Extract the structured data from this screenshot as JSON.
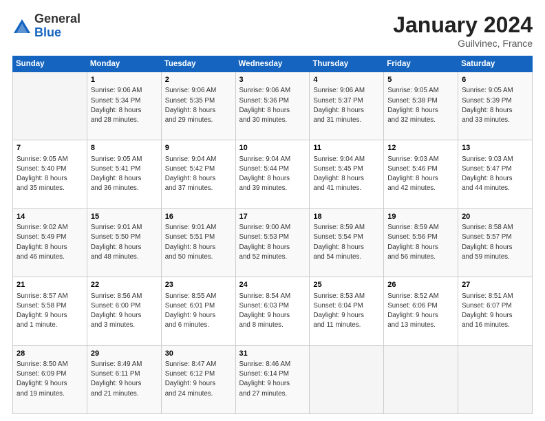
{
  "header": {
    "logo_general": "General",
    "logo_blue": "Blue",
    "title": "January 2024",
    "location": "Guilvinec, France"
  },
  "days_of_week": [
    "Sunday",
    "Monday",
    "Tuesday",
    "Wednesday",
    "Thursday",
    "Friday",
    "Saturday"
  ],
  "weeks": [
    [
      {
        "day": "",
        "info": ""
      },
      {
        "day": "1",
        "info": "Sunrise: 9:06 AM\nSunset: 5:34 PM\nDaylight: 8 hours\nand 28 minutes."
      },
      {
        "day": "2",
        "info": "Sunrise: 9:06 AM\nSunset: 5:35 PM\nDaylight: 8 hours\nand 29 minutes."
      },
      {
        "day": "3",
        "info": "Sunrise: 9:06 AM\nSunset: 5:36 PM\nDaylight: 8 hours\nand 30 minutes."
      },
      {
        "day": "4",
        "info": "Sunrise: 9:06 AM\nSunset: 5:37 PM\nDaylight: 8 hours\nand 31 minutes."
      },
      {
        "day": "5",
        "info": "Sunrise: 9:05 AM\nSunset: 5:38 PM\nDaylight: 8 hours\nand 32 minutes."
      },
      {
        "day": "6",
        "info": "Sunrise: 9:05 AM\nSunset: 5:39 PM\nDaylight: 8 hours\nand 33 minutes."
      }
    ],
    [
      {
        "day": "7",
        "info": "Sunrise: 9:05 AM\nSunset: 5:40 PM\nDaylight: 8 hours\nand 35 minutes."
      },
      {
        "day": "8",
        "info": "Sunrise: 9:05 AM\nSunset: 5:41 PM\nDaylight: 8 hours\nand 36 minutes."
      },
      {
        "day": "9",
        "info": "Sunrise: 9:04 AM\nSunset: 5:42 PM\nDaylight: 8 hours\nand 37 minutes."
      },
      {
        "day": "10",
        "info": "Sunrise: 9:04 AM\nSunset: 5:44 PM\nDaylight: 8 hours\nand 39 minutes."
      },
      {
        "day": "11",
        "info": "Sunrise: 9:04 AM\nSunset: 5:45 PM\nDaylight: 8 hours\nand 41 minutes."
      },
      {
        "day": "12",
        "info": "Sunrise: 9:03 AM\nSunset: 5:46 PM\nDaylight: 8 hours\nand 42 minutes."
      },
      {
        "day": "13",
        "info": "Sunrise: 9:03 AM\nSunset: 5:47 PM\nDaylight: 8 hours\nand 44 minutes."
      }
    ],
    [
      {
        "day": "14",
        "info": "Sunrise: 9:02 AM\nSunset: 5:49 PM\nDaylight: 8 hours\nand 46 minutes."
      },
      {
        "day": "15",
        "info": "Sunrise: 9:01 AM\nSunset: 5:50 PM\nDaylight: 8 hours\nand 48 minutes."
      },
      {
        "day": "16",
        "info": "Sunrise: 9:01 AM\nSunset: 5:51 PM\nDaylight: 8 hours\nand 50 minutes."
      },
      {
        "day": "17",
        "info": "Sunrise: 9:00 AM\nSunset: 5:53 PM\nDaylight: 8 hours\nand 52 minutes."
      },
      {
        "day": "18",
        "info": "Sunrise: 8:59 AM\nSunset: 5:54 PM\nDaylight: 8 hours\nand 54 minutes."
      },
      {
        "day": "19",
        "info": "Sunrise: 8:59 AM\nSunset: 5:56 PM\nDaylight: 8 hours\nand 56 minutes."
      },
      {
        "day": "20",
        "info": "Sunrise: 8:58 AM\nSunset: 5:57 PM\nDaylight: 8 hours\nand 59 minutes."
      }
    ],
    [
      {
        "day": "21",
        "info": "Sunrise: 8:57 AM\nSunset: 5:58 PM\nDaylight: 9 hours\nand 1 minute."
      },
      {
        "day": "22",
        "info": "Sunrise: 8:56 AM\nSunset: 6:00 PM\nDaylight: 9 hours\nand 3 minutes."
      },
      {
        "day": "23",
        "info": "Sunrise: 8:55 AM\nSunset: 6:01 PM\nDaylight: 9 hours\nand 6 minutes."
      },
      {
        "day": "24",
        "info": "Sunrise: 8:54 AM\nSunset: 6:03 PM\nDaylight: 9 hours\nand 8 minutes."
      },
      {
        "day": "25",
        "info": "Sunrise: 8:53 AM\nSunset: 6:04 PM\nDaylight: 9 hours\nand 11 minutes."
      },
      {
        "day": "26",
        "info": "Sunrise: 8:52 AM\nSunset: 6:06 PM\nDaylight: 9 hours\nand 13 minutes."
      },
      {
        "day": "27",
        "info": "Sunrise: 8:51 AM\nSunset: 6:07 PM\nDaylight: 9 hours\nand 16 minutes."
      }
    ],
    [
      {
        "day": "28",
        "info": "Sunrise: 8:50 AM\nSunset: 6:09 PM\nDaylight: 9 hours\nand 19 minutes."
      },
      {
        "day": "29",
        "info": "Sunrise: 8:49 AM\nSunset: 6:11 PM\nDaylight: 9 hours\nand 21 minutes."
      },
      {
        "day": "30",
        "info": "Sunrise: 8:47 AM\nSunset: 6:12 PM\nDaylight: 9 hours\nand 24 minutes."
      },
      {
        "day": "31",
        "info": "Sunrise: 8:46 AM\nSunset: 6:14 PM\nDaylight: 9 hours\nand 27 minutes."
      },
      {
        "day": "",
        "info": ""
      },
      {
        "day": "",
        "info": ""
      },
      {
        "day": "",
        "info": ""
      }
    ]
  ]
}
